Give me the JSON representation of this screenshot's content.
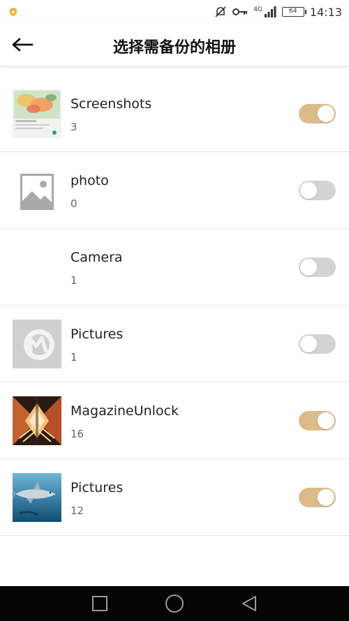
{
  "status_bar": {
    "network_label": "4G",
    "battery_level": "64",
    "time": "14:13"
  },
  "header": {
    "title": "选择需备份的相册"
  },
  "albums": [
    {
      "name": "Screenshots",
      "count": "3",
      "enabled": true,
      "thumb_icon": "screenshot-thumbnail"
    },
    {
      "name": "photo",
      "count": "0",
      "enabled": false,
      "thumb_icon": "image-placeholder-icon"
    },
    {
      "name": "Camera",
      "count": "1",
      "enabled": false,
      "thumb_icon": ""
    },
    {
      "name": "Pictures",
      "count": "1",
      "enabled": false,
      "thumb_icon": "app-logo-thumbnail"
    },
    {
      "name": "MagazineUnlock",
      "count": "16",
      "enabled": true,
      "thumb_icon": "magazine-thumbnail"
    },
    {
      "name": "Pictures",
      "count": "12",
      "enabled": true,
      "thumb_icon": "shark-thumbnail"
    }
  ],
  "colors": {
    "toggle_on": "#dcbb8b",
    "toggle_off": "#d3d3d3",
    "nav_bar": "#050505"
  }
}
